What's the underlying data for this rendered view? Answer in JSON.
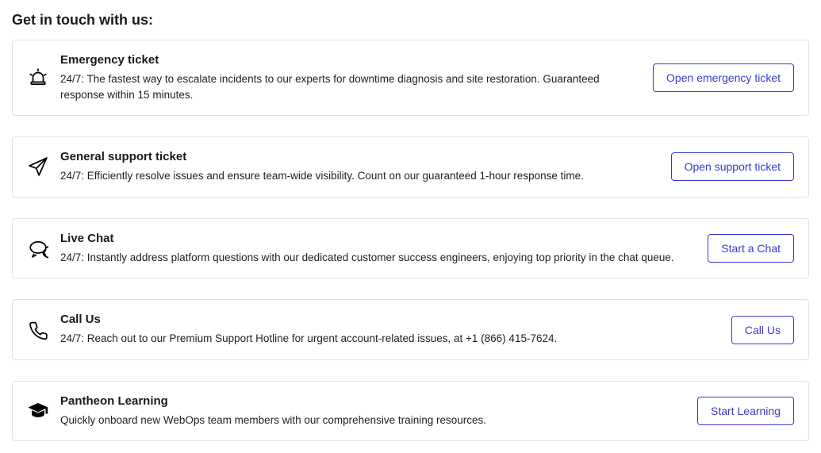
{
  "page_title": "Get in touch with us:",
  "cards": [
    {
      "icon": "alarm-icon",
      "title": "Emergency ticket",
      "desc": "24/7: The fastest way to escalate incidents to our experts for downtime diagnosis and site restoration. Guaranteed response within 15 minutes.",
      "button": "Open emergency ticket"
    },
    {
      "icon": "paper-plane-icon",
      "title": "General support ticket",
      "desc": "24/7: Efficiently resolve issues and ensure team-wide visibility. Count on our guaranteed 1-hour response time.",
      "button": "Open support ticket"
    },
    {
      "icon": "chat-bubble-icon",
      "title": "Live Chat",
      "desc": "24/7: Instantly address platform questions with our dedicated customer success engineers, enjoying top priority in the chat queue.",
      "button": "Start a Chat"
    },
    {
      "icon": "phone-icon",
      "title": "Call Us",
      "desc": "24/7: Reach out to our Premium Support Hotline for urgent account-related issues, at +1 (866) 415-7624.",
      "button": "Call Us"
    },
    {
      "icon": "graduation-cap-icon",
      "title": "Pantheon Learning",
      "desc": "Quickly onboard new WebOps team members with our comprehensive training resources.",
      "button": "Start Learning"
    }
  ]
}
